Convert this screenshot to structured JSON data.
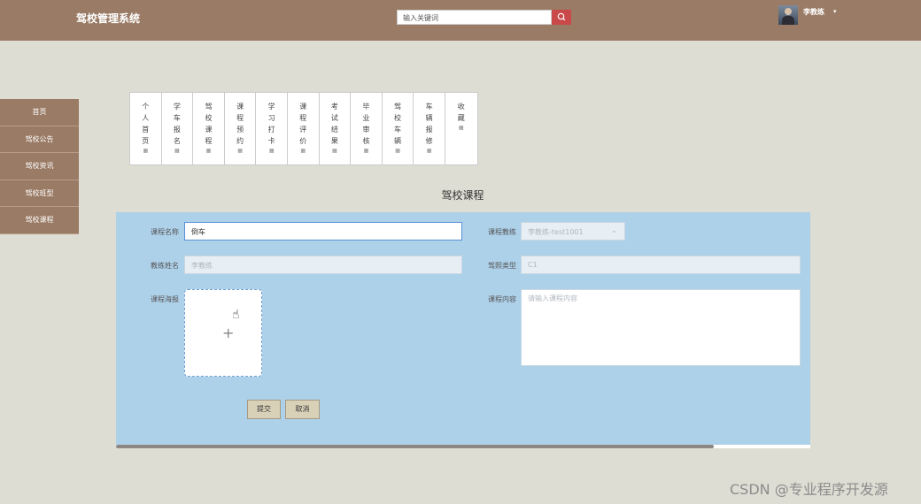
{
  "header": {
    "brand": "驾校管理系统",
    "search_placeholder": "输入关键词",
    "username": "李教练",
    "caret": "▾"
  },
  "sidebar": {
    "items": [
      {
        "label": "首页"
      },
      {
        "label": "驾校公告"
      },
      {
        "label": "驾校资讯"
      },
      {
        "label": "驾校班型"
      },
      {
        "label": "驾校课程"
      }
    ]
  },
  "tabs": [
    {
      "label": "个人首页"
    },
    {
      "label": "学车报名"
    },
    {
      "label": "驾校课程"
    },
    {
      "label": "课程预约"
    },
    {
      "label": "学习打卡"
    },
    {
      "label": "课程评价"
    },
    {
      "label": "考试结果"
    },
    {
      "label": "毕业审核"
    },
    {
      "label": "驾校车辆"
    },
    {
      "label": "车辆报修"
    },
    {
      "label": "收藏"
    }
  ],
  "tab_icon": "▦",
  "page_title": "驾校课程",
  "form": {
    "course_name_label": "课程名称",
    "course_name_value": "倒车",
    "coach_label": "课程教练",
    "coach_value": "李教练-test1001",
    "coach_name_label": "教练姓名",
    "coach_name_value": "李教练",
    "license_type_label": "驾照类型",
    "license_type_value": "C1",
    "poster_label": "课程海报",
    "content_label": "课程内容",
    "content_placeholder": "请输入课程内容",
    "submit_label": "提交",
    "cancel_label": "取消"
  },
  "watermark": "CSDN @专业程序开发源",
  "colors": {
    "header": "#9a7b65",
    "panel": "#aed1ea",
    "search_button": "#c9484a",
    "background": "#deddd3"
  },
  "icons": {
    "search": "search-icon",
    "upload": "plus-icon",
    "cursor": "hand-cursor-icon"
  }
}
